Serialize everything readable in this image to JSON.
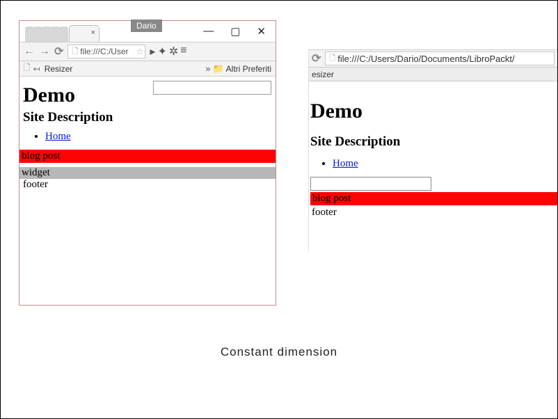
{
  "caption": "Constant dimension",
  "left_window": {
    "tab_tooltip": "Dario",
    "win_controls": {
      "min": "—",
      "max": "▢",
      "close": "✕"
    },
    "toolbar": {
      "back": "←",
      "forward": "→",
      "reload": "⟳",
      "url": "file:///C:/User",
      "star": "☆",
      "drop": "▸",
      "puzzle": "✦",
      "gear": "✲",
      "menu": "≡"
    },
    "bookmarks_bar": {
      "anchor_icon": "↤",
      "resizer_label": "Resizer",
      "chevrons": "»",
      "folder_label": "Altri Preferiti"
    },
    "page": {
      "title_h1": "Demo",
      "subtitle_h2": "Site Description",
      "nav_home": "Home",
      "blog_post": "blog post",
      "widget": "widget",
      "footer": "footer"
    }
  },
  "right_window": {
    "toolbar": {
      "reload": "⟳",
      "url": "file:///C:/Users/Dario/Documents/LibroPackt/"
    },
    "bookmarks_bar": {
      "label_fragment": "esizer"
    },
    "page": {
      "title_h1": "Demo",
      "subtitle_h2": "Site Description",
      "nav_home": "Home",
      "blog_post": "blog post",
      "footer": "footer"
    }
  }
}
